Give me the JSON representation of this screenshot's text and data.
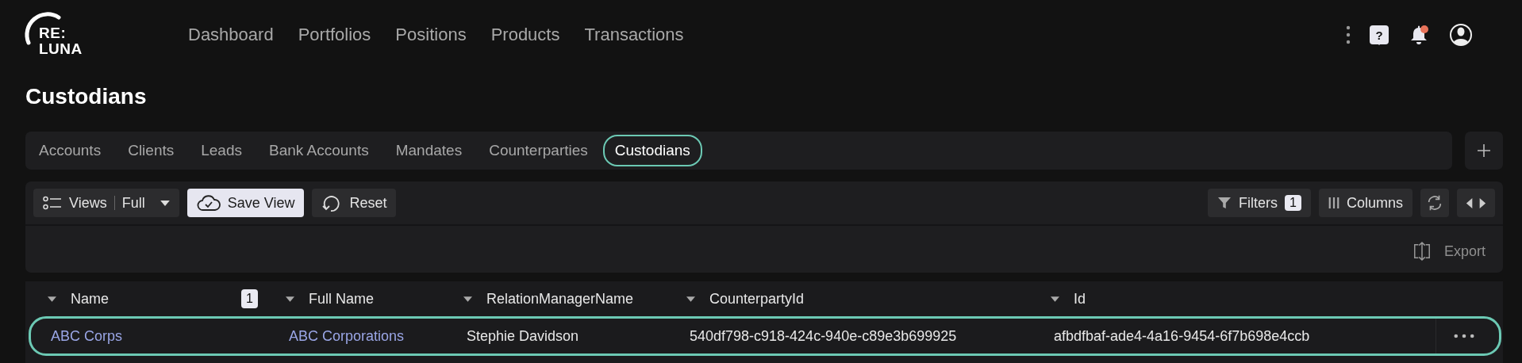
{
  "logo": {
    "line1": "RE:",
    "line2": "LUNA"
  },
  "nav": [
    {
      "label": "Dashboard",
      "selected": false
    },
    {
      "label": "Portfolios",
      "selected": false
    },
    {
      "label": "Positions",
      "selected": false
    },
    {
      "label": "Products",
      "selected": false
    },
    {
      "label": "Transactions",
      "selected": false
    }
  ],
  "header_actions": {
    "help": "?",
    "notifications_unread": true
  },
  "page_title": "Custodians",
  "tabs": [
    {
      "label": "Accounts",
      "selected": false
    },
    {
      "label": "Clients",
      "selected": false
    },
    {
      "label": "Leads",
      "selected": false
    },
    {
      "label": "Bank Accounts",
      "selected": false
    },
    {
      "label": "Mandates",
      "selected": false
    },
    {
      "label": "Counterparties",
      "selected": false
    },
    {
      "label": "Custodians",
      "selected": true
    }
  ],
  "toolbar": {
    "views_label": "Views",
    "views_value": "Full",
    "save_view": "Save View",
    "reset": "Reset",
    "filters": "Filters",
    "filters_count": "1",
    "columns": "Columns",
    "export": "Export"
  },
  "table": {
    "columns": [
      {
        "label": "Name",
        "badge": "1"
      },
      {
        "label": "Full Name"
      },
      {
        "label": "RelationManagerName"
      },
      {
        "label": "CounterpartyId"
      },
      {
        "label": "Id"
      }
    ],
    "rows": [
      {
        "selected": true,
        "cells": [
          {
            "text": "ABC Corps",
            "kind": "link"
          },
          {
            "text": "ABC Corporations",
            "kind": "link"
          },
          {
            "text": "Stephie Davidson",
            "kind": "text"
          },
          {
            "text": "540df798-c918-424c-940e-c89e3b699925",
            "kind": "text"
          },
          {
            "text": "afbdfbaf-ade4-4a16-9454-6f7b698e4ccb",
            "kind": "text"
          }
        ]
      }
    ]
  }
}
